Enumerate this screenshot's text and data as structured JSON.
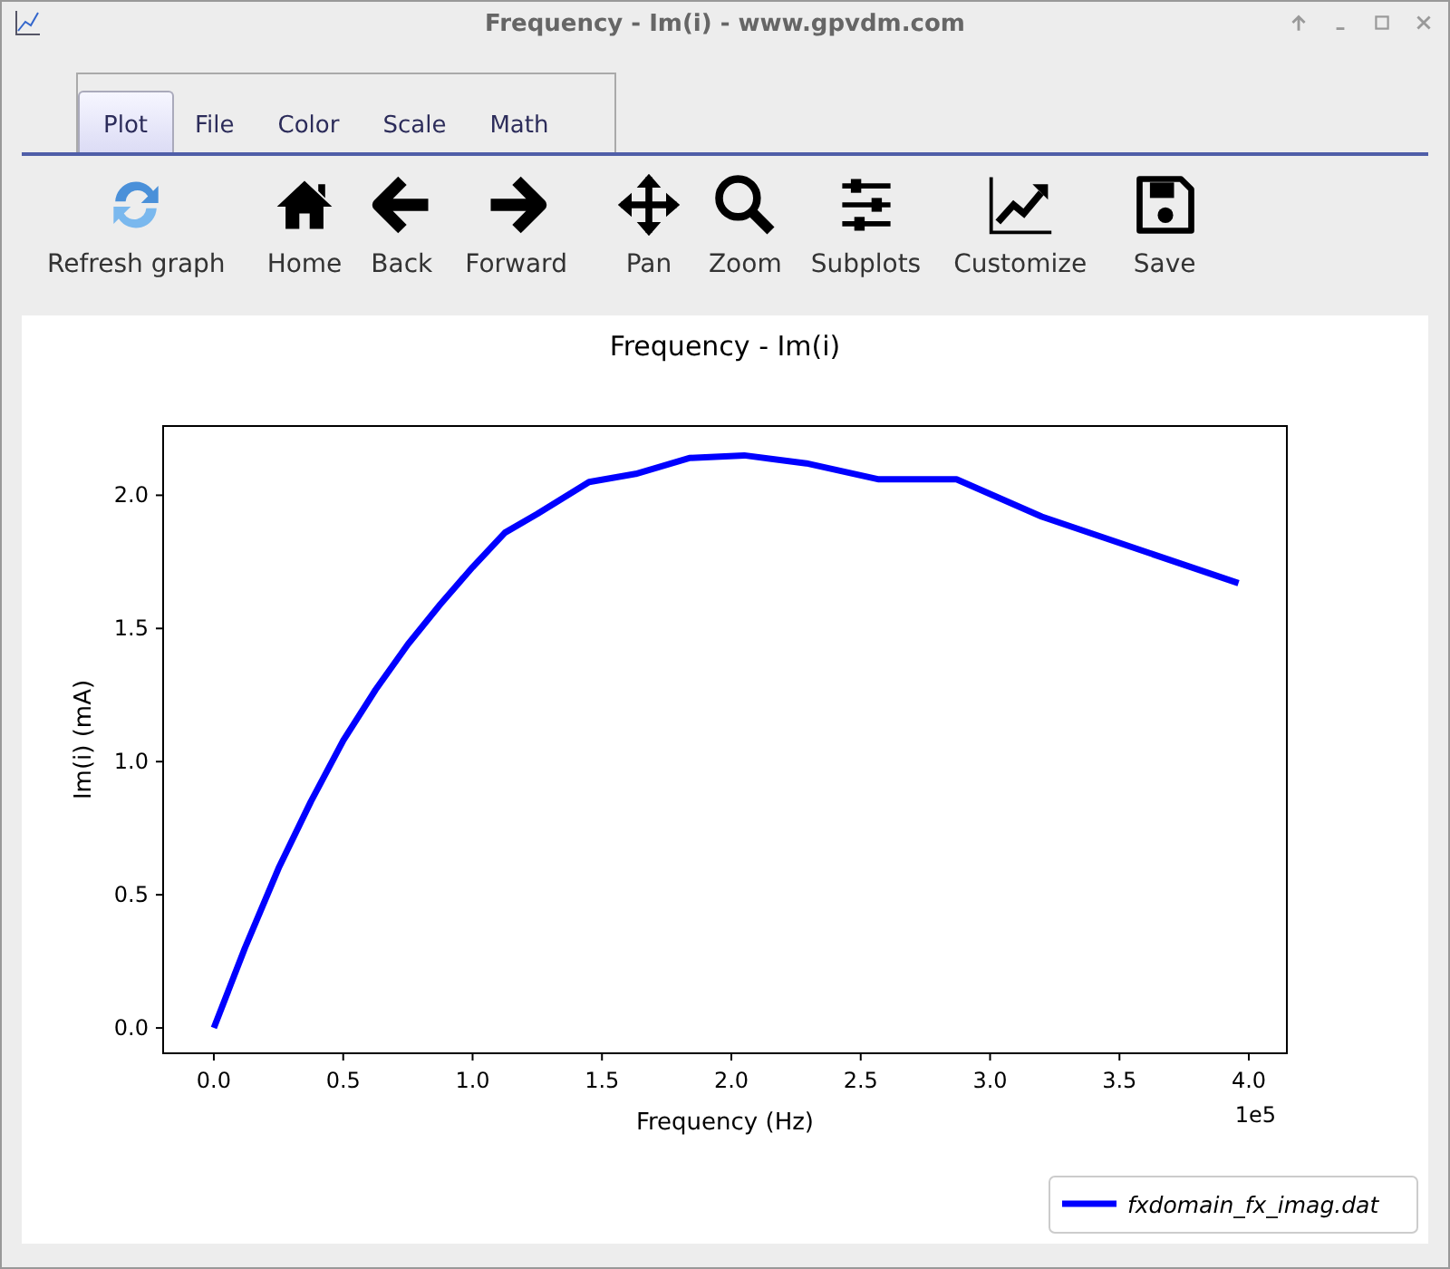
{
  "window": {
    "title": "Frequency - Im(i) - www.gpvdm.com"
  },
  "tabs": [
    {
      "label": "Plot",
      "selected": true
    },
    {
      "label": "File",
      "selected": false
    },
    {
      "label": "Color",
      "selected": false
    },
    {
      "label": "Scale",
      "selected": false
    },
    {
      "label": "Math",
      "selected": false
    }
  ],
  "toolbar": [
    "Refresh graph",
    "Home",
    "Back",
    "Forward",
    "Pan",
    "Zoom",
    "Subplots",
    "Customize",
    "Save"
  ],
  "plot": {
    "chart_data": {
      "type": "line",
      "title": "Frequency - Im(i)",
      "xlabel": "Frequency (Hz)",
      "ylabel": "Im(i) (mA)",
      "x": [
        0,
        0.12,
        0.25,
        0.375,
        0.5,
        0.625,
        0.75,
        0.875,
        1.0,
        1.125,
        1.25,
        1.45,
        1.63,
        1.84,
        2.05,
        2.29,
        2.57,
        2.87,
        3.2,
        3.96
      ],
      "series": [
        {
          "name": "fxdomain_fx_imag.dat",
          "color": "#0000ff",
          "values": [
            0,
            0.3,
            0.6,
            0.85,
            1.08,
            1.27,
            1.44,
            1.59,
            1.73,
            1.86,
            1.93,
            2.05,
            2.08,
            2.14,
            2.15,
            2.12,
            2.06,
            2.06,
            1.92,
            1.67
          ]
        }
      ],
      "xlim": [
        -0.196,
        4.147
      ],
      "ylim": [
        -0.095,
        2.26
      ],
      "xticks": [
        {
          "value": 0,
          "label": "0.0"
        },
        {
          "value": 0.5,
          "label": "0.5"
        },
        {
          "value": 1,
          "label": "1.0"
        },
        {
          "value": 1.5,
          "label": "1.5"
        },
        {
          "value": 2,
          "label": "2.0"
        },
        {
          "value": 2.5,
          "label": "2.5"
        },
        {
          "value": 3,
          "label": "3.0"
        },
        {
          "value": 3.5,
          "label": "3.5"
        },
        {
          "value": 4,
          "label": "4.0"
        }
      ],
      "yticks": [
        {
          "value": 0,
          "label": "0.0"
        },
        {
          "value": 0.5,
          "label": "0.5"
        },
        {
          "value": 1,
          "label": "1.0"
        },
        {
          "value": 1.5,
          "label": "1.5"
        },
        {
          "value": 2,
          "label": "2.0"
        }
      ],
      "annotations": [
        "1e5"
      ]
    }
  }
}
